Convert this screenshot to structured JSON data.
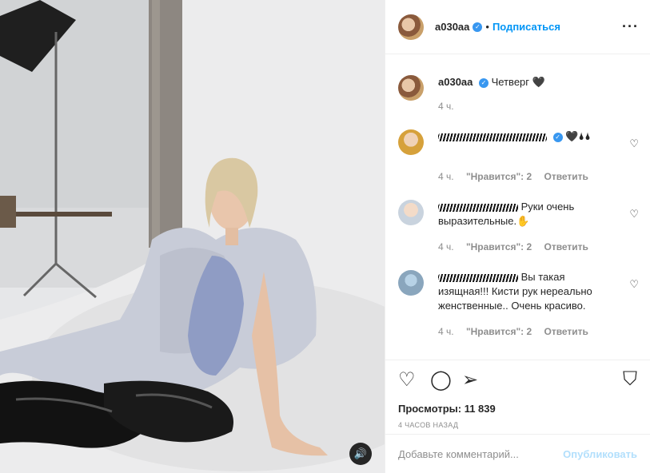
{
  "post": {
    "username": "a030aa",
    "follow_label": "Подписаться",
    "caption": "Четверг 🖤",
    "caption_time": "4 ч.",
    "views_label": "Просмотры: 11 839",
    "posted_ago": "4 ЧАСОВ НАЗАД"
  },
  "comments": [
    {
      "user": "doktor…",
      "text": "🖤🌢🌢",
      "time": "4 ч.",
      "likes": "\"Нравится\": 2",
      "reply": "Ответить"
    },
    {
      "user": "…",
      "text": "Руки очень выразительные.✋",
      "time": "4 ч.",
      "likes": "\"Нравится\": 2",
      "reply": "Ответить"
    },
    {
      "user": "…",
      "text": "Вы такая изящная!!! Кисти рук нереально женственные.. Очень красиво.",
      "time": "4 ч.",
      "likes": "\"Нравится\": 2",
      "reply": "Ответить"
    }
  ],
  "add_comment": {
    "placeholder": "Добавьте комментарий...",
    "publish_label": "Опубликовать"
  }
}
